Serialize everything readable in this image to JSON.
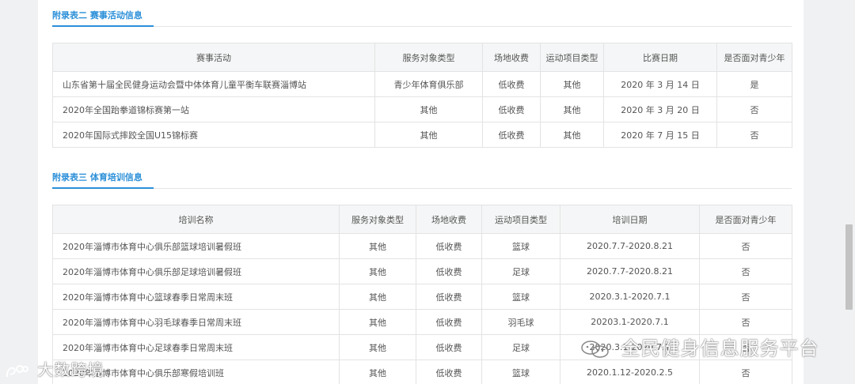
{
  "section2": {
    "title": "附录表二 赛事活动信息",
    "headers": [
      "赛事活动",
      "服务对象类型",
      "场地收费",
      "运动项目类型",
      "比赛日期",
      "是否面对青少年"
    ],
    "rows": [
      [
        "山东省第十届全民健身运动会暨中体体育儿童平衡车联赛淄博站",
        "青少年体育俱乐部",
        "低收费",
        "其他",
        "2020 年 3 月 14 日",
        "是"
      ],
      [
        "2020年全国跆拳道锦标赛第一站",
        "其他",
        "低收费",
        "其他",
        "2020 年 3 月 20 日",
        "否"
      ],
      [
        "2020年国际式摔跤全国U15锦标赛",
        "其他",
        "低收费",
        "其他",
        "2020 年 7 月 15 日",
        "否"
      ]
    ]
  },
  "section3": {
    "title": "附录表三 体育培训信息",
    "headers": [
      "培训名称",
      "服务对象类型",
      "场地收费",
      "运动项目类型",
      "培训日期",
      "是否面对青少年"
    ],
    "rows": [
      [
        "2020年淄博市体育中心俱乐部篮球培训暑假班",
        "其他",
        "低收费",
        "篮球",
        "2020.7.7-2020.8.21",
        "否"
      ],
      [
        "2020年淄博市体育中心俱乐部足球培训暑假班",
        "其他",
        "低收费",
        "足球",
        "2020.7.7-2020.8.21",
        "否"
      ],
      [
        "2020年淄博市体育中心篮球春季日常周末班",
        "其他",
        "低收费",
        "篮球",
        "2020.3.1-2020.7.1",
        "否"
      ],
      [
        "2020年淄博市体育中心羽毛球春季日常周末班",
        "其他",
        "低收费",
        "羽毛球",
        "20203.1-2020.7.1",
        "否"
      ],
      [
        "2020年淄博市体育中心足球春季日常周末班",
        "其他",
        "低收费",
        "足球",
        "2020.3.1-2020.7.1",
        "否"
      ],
      [
        "2020年淄博市体育中心俱乐部寒假培训班",
        "其他",
        "低收费",
        "篮球",
        "2020.1.12-2020.2.5",
        "否"
      ]
    ]
  },
  "watermarks": {
    "left": "大数跨境",
    "right": "全民健身信息服务平台"
  }
}
